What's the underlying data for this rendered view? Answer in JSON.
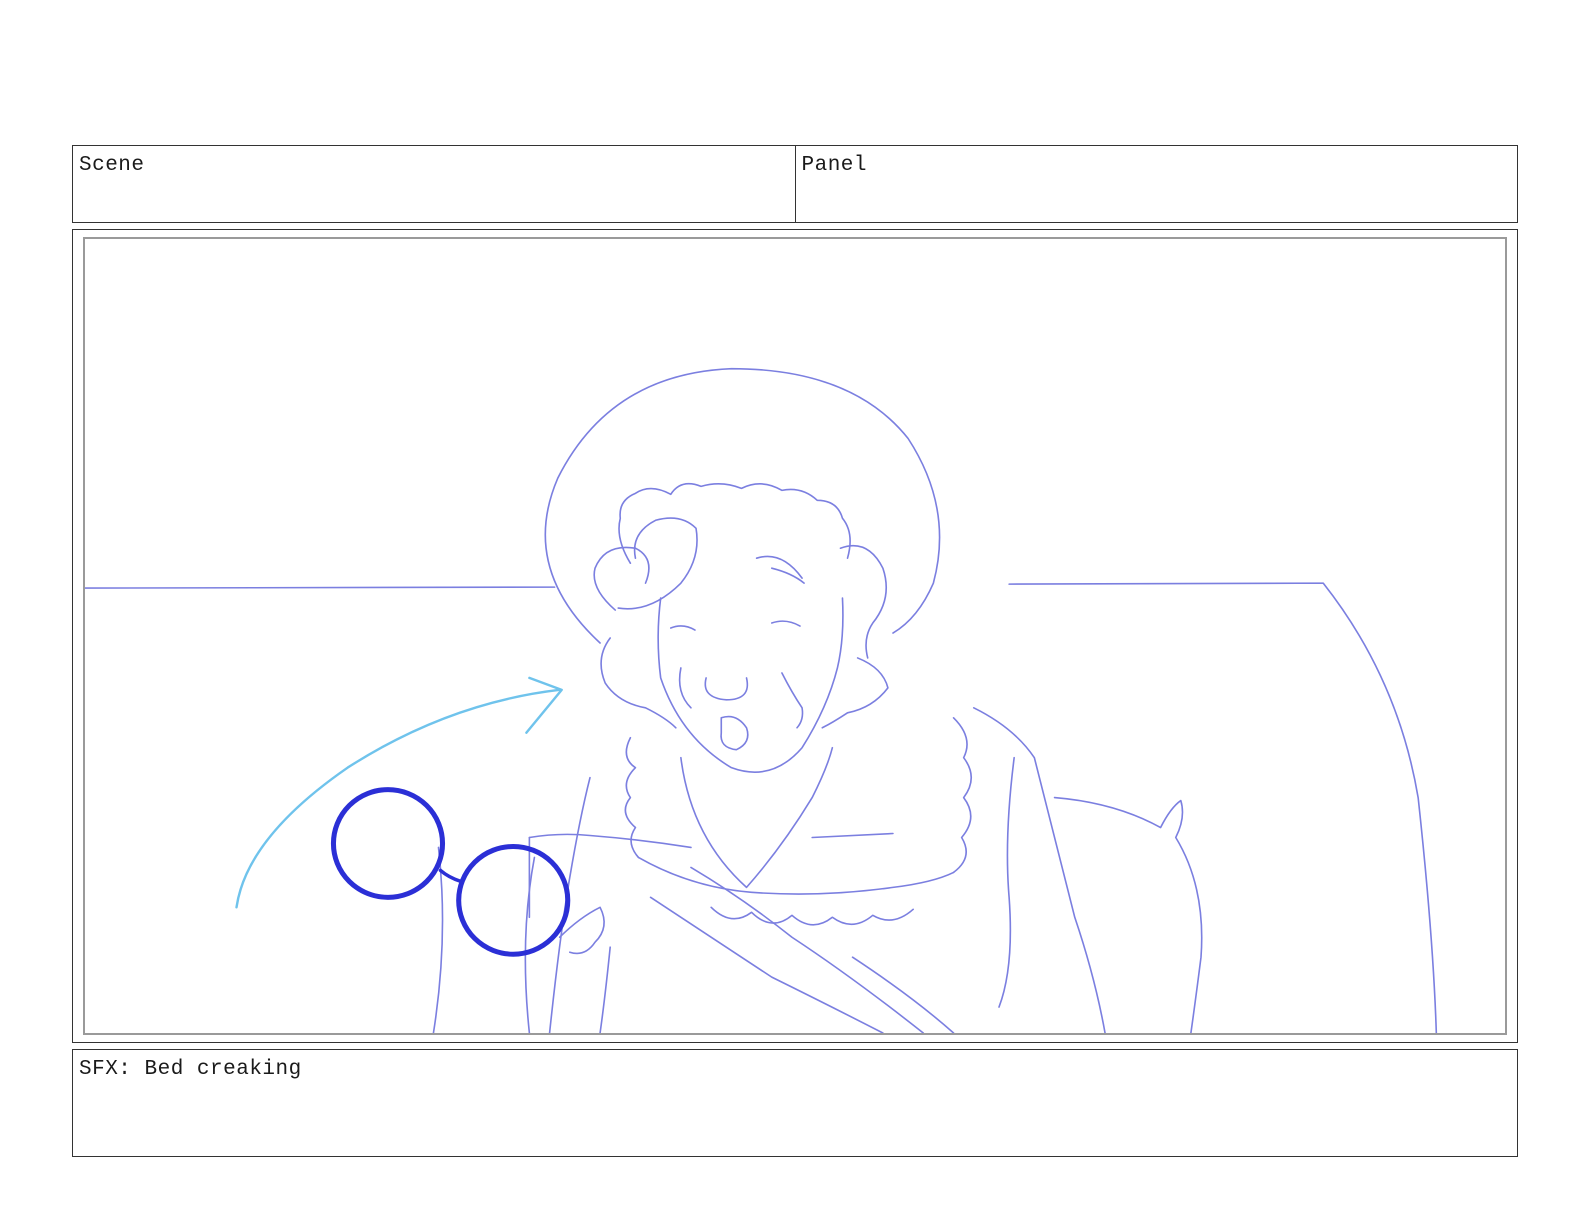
{
  "header": {
    "scene_label": "Scene",
    "panel_label": "Panel"
  },
  "sketch": {
    "subject": "",
    "line_color": "#7b7fe0",
    "dark_line_color": "#2b2fd6",
    "arrow_color": "#6fc3ec"
  },
  "notes": {
    "text": "SFX: Bed creaking"
  }
}
